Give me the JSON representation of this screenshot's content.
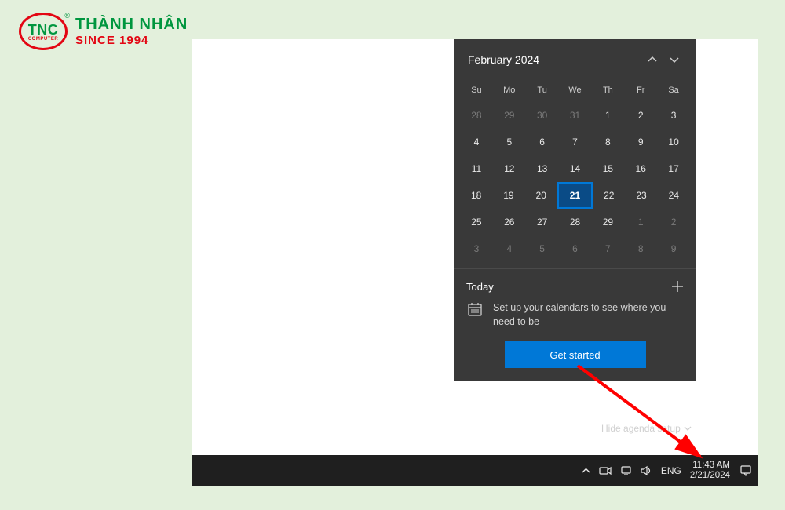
{
  "logo": {
    "badge_main": "TNC",
    "badge_sub": "COMPUTER",
    "line1": "THÀNH NHÂN",
    "line2": "SINCE 1994"
  },
  "calendar": {
    "month_label": "February 2024",
    "dow": [
      "Su",
      "Mo",
      "Tu",
      "We",
      "Th",
      "Fr",
      "Sa"
    ],
    "weeks": [
      [
        {
          "n": "28",
          "other": true
        },
        {
          "n": "29",
          "other": true
        },
        {
          "n": "30",
          "other": true
        },
        {
          "n": "31",
          "other": true
        },
        {
          "n": "1"
        },
        {
          "n": "2"
        },
        {
          "n": "3"
        }
      ],
      [
        {
          "n": "4"
        },
        {
          "n": "5"
        },
        {
          "n": "6"
        },
        {
          "n": "7"
        },
        {
          "n": "8"
        },
        {
          "n": "9"
        },
        {
          "n": "10"
        }
      ],
      [
        {
          "n": "11"
        },
        {
          "n": "12"
        },
        {
          "n": "13"
        },
        {
          "n": "14"
        },
        {
          "n": "15"
        },
        {
          "n": "16"
        },
        {
          "n": "17"
        }
      ],
      [
        {
          "n": "18"
        },
        {
          "n": "19"
        },
        {
          "n": "20"
        },
        {
          "n": "21",
          "today": true
        },
        {
          "n": "22"
        },
        {
          "n": "23"
        },
        {
          "n": "24"
        }
      ],
      [
        {
          "n": "25"
        },
        {
          "n": "26"
        },
        {
          "n": "27"
        },
        {
          "n": "28"
        },
        {
          "n": "29"
        },
        {
          "n": "1",
          "other": true
        },
        {
          "n": "2",
          "other": true
        }
      ],
      [
        {
          "n": "3",
          "other": true
        },
        {
          "n": "4",
          "other": true
        },
        {
          "n": "5",
          "other": true
        },
        {
          "n": "6",
          "other": true
        },
        {
          "n": "7",
          "other": true
        },
        {
          "n": "8",
          "other": true
        },
        {
          "n": "9",
          "other": true
        }
      ]
    ]
  },
  "agenda": {
    "today_label": "Today",
    "message": "Set up your calendars to see where you need to be",
    "button": "Get started",
    "hide_label": "Hide agenda setup"
  },
  "taskbar": {
    "lang": "ENG",
    "time": "11:43 AM",
    "date": "2/21/2024"
  }
}
